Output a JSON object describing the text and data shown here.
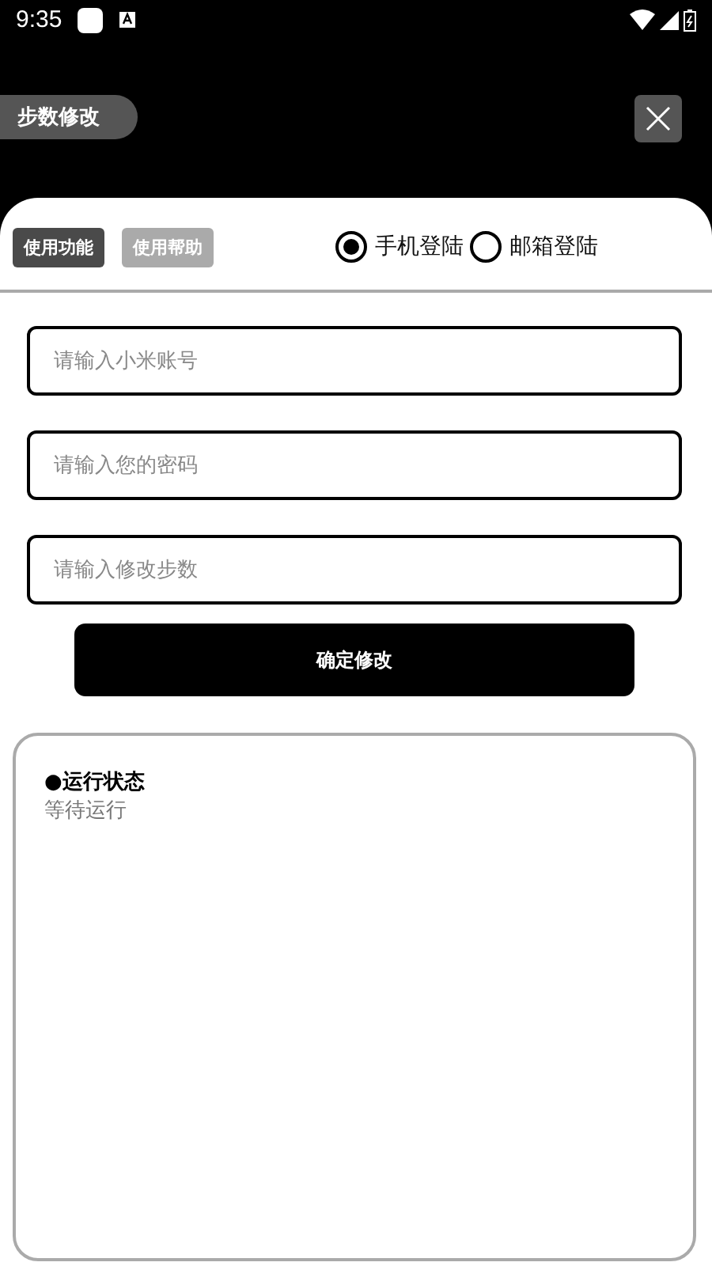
{
  "status_bar": {
    "time": "9:35"
  },
  "header": {
    "title": "步数修改"
  },
  "tabs": [
    {
      "label": "使用功能",
      "selected": true
    },
    {
      "label": "使用帮助",
      "selected": false
    }
  ],
  "login_options": [
    {
      "label": "手机登陆",
      "selected": true
    },
    {
      "label": "邮箱登陆",
      "selected": false
    }
  ],
  "fields": [
    {
      "placeholder": "请输入小米账号"
    },
    {
      "placeholder": "请输入您的密码"
    },
    {
      "placeholder": "请输入修改步数"
    }
  ],
  "submit_button": "确定修改",
  "status_panel": {
    "title": "●运行状态",
    "message": "等待运行"
  }
}
